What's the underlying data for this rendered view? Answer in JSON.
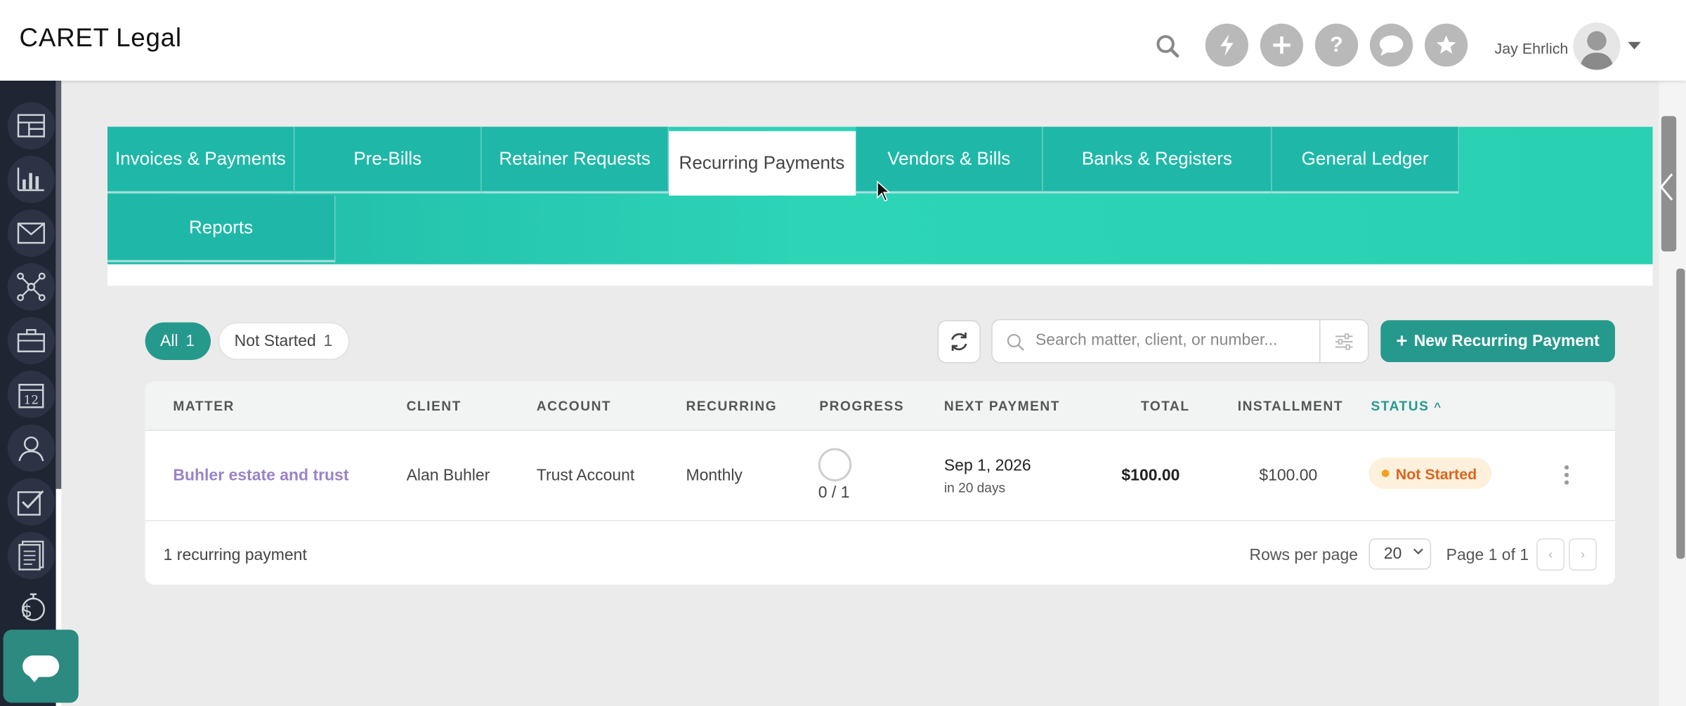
{
  "header": {
    "logo_brand": "CARET",
    "logo_product": "Legal",
    "user_name": "Jay Ehrlich"
  },
  "tabs": [
    {
      "label": "Invoices & Payments"
    },
    {
      "label": "Pre-Bills"
    },
    {
      "label": "Retainer Requests"
    },
    {
      "label": "Recurring Payments",
      "active": true
    },
    {
      "label": "Vendors & Bills"
    },
    {
      "label": "Banks & Registers"
    },
    {
      "label": "General Ledger"
    },
    {
      "label": "Reports"
    }
  ],
  "filters": {
    "all": {
      "label": "All",
      "count": "1"
    },
    "not_started": {
      "label": "Not Started",
      "count": "1"
    }
  },
  "search": {
    "placeholder": "Search matter, client, or number..."
  },
  "new_button": {
    "label": "New Recurring Payment"
  },
  "table": {
    "columns": [
      "MATTER",
      "CLIENT",
      "ACCOUNT",
      "RECURRING",
      "PROGRESS",
      "NEXT PAYMENT",
      "TOTAL",
      "INSTALLMENT",
      "STATUS"
    ],
    "sort_indicator": "^",
    "rows": [
      {
        "matter": "Buhler estate and trust",
        "client": "Alan Buhler",
        "account": "Trust Account",
        "recurring": "Monthly",
        "progress": "0 / 1",
        "next_payment": "Sep 1, 2026",
        "next_payment_sub": "in 20 days",
        "total": "$100.00",
        "installment": "$100.00",
        "status": "Not Started"
      }
    ]
  },
  "footer": {
    "count_text": "1 recurring payment",
    "rows_per_page_label": "Rows per page",
    "rows_per_page_value": "20",
    "page_text": "Page 1 of 1"
  },
  "colors": {
    "accent": "#26998d",
    "tab_bar": "#2dd4b6",
    "status_not_started": "#d9661f",
    "matter_link": "#9b83c8"
  }
}
